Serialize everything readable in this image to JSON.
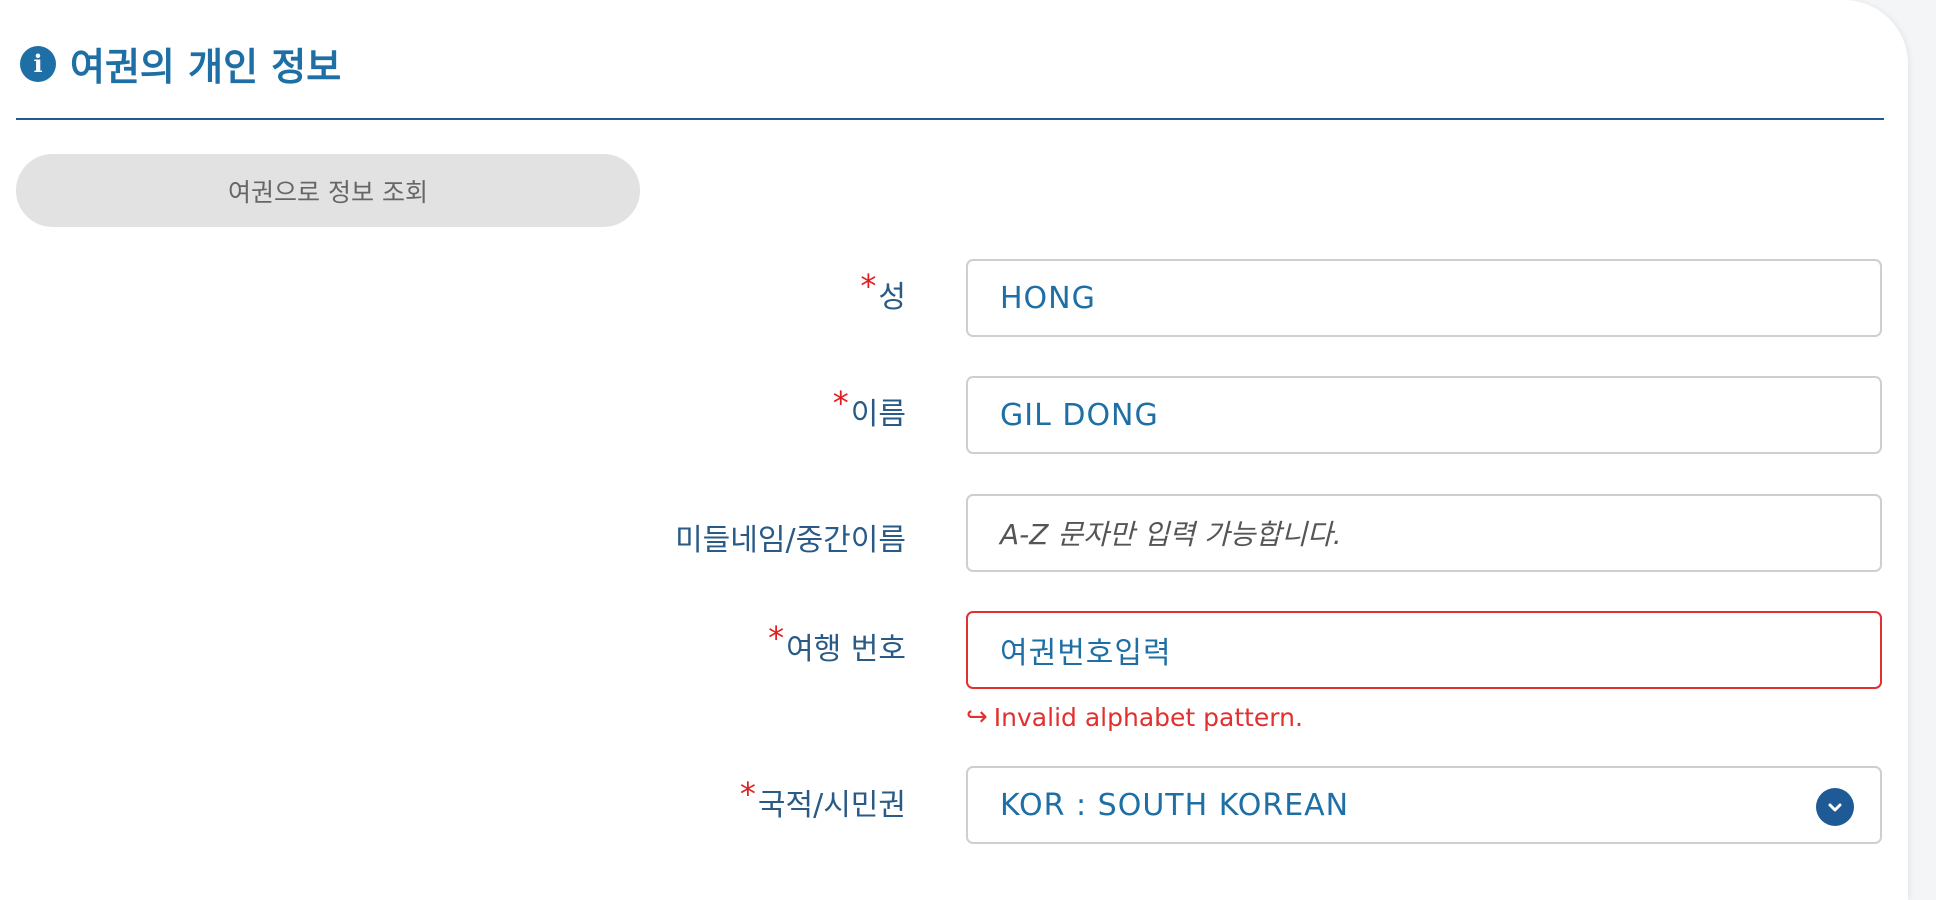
{
  "header": {
    "icon": "info-icon",
    "title": "여권의 개인 정보"
  },
  "lookup_button": {
    "label": "여권으로 정보 조회"
  },
  "form": {
    "required_mark": "*",
    "surname": {
      "label": "성",
      "required": true,
      "value": "HONG"
    },
    "given_name": {
      "label": "이름",
      "required": true,
      "value": "GIL DONG"
    },
    "middle_name": {
      "label": "미들네임/중간이름",
      "required": false,
      "value": "",
      "placeholder": "A-Z 문자만 입력 가능합니다."
    },
    "travel_number": {
      "label": "여행 번호",
      "required": true,
      "value": "여권번호입력",
      "error": "Invalid alphabet pattern."
    },
    "nationality": {
      "label": "국적/시민권",
      "required": true,
      "selected": "KOR : SOUTH KOREAN",
      "icon": "chevron-down-icon"
    }
  },
  "colors": {
    "accent": "#1d6fa5",
    "divider": "#1d5a96",
    "error": "#e03030",
    "required": "#e02020"
  }
}
